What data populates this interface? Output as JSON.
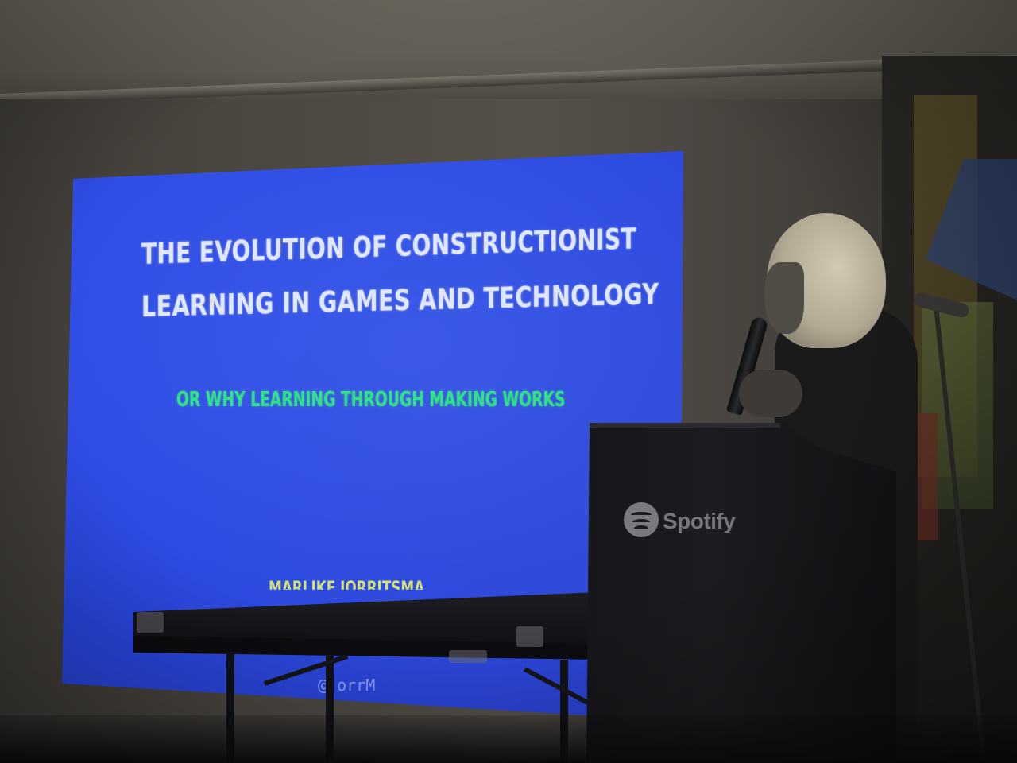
{
  "slide": {
    "title_line_1": "THE EVOLUTION OF CONSTRUCTIONIST",
    "title_line_2": "LEARNING IN GAMES AND TECHNOLOGY",
    "subtitle": "OR WHY LEARNING THROUGH MAKING WORKS",
    "author_partial": "MARLIKE JORRITSMA",
    "handle_partial": "@ orrM",
    "background_color": "#2d4ae8",
    "title_color": "#dfe6ff",
    "subtitle_color": "#33e08a"
  },
  "podium": {
    "brand": "Spotify",
    "logo_icon": "spotify-logo-icon"
  }
}
